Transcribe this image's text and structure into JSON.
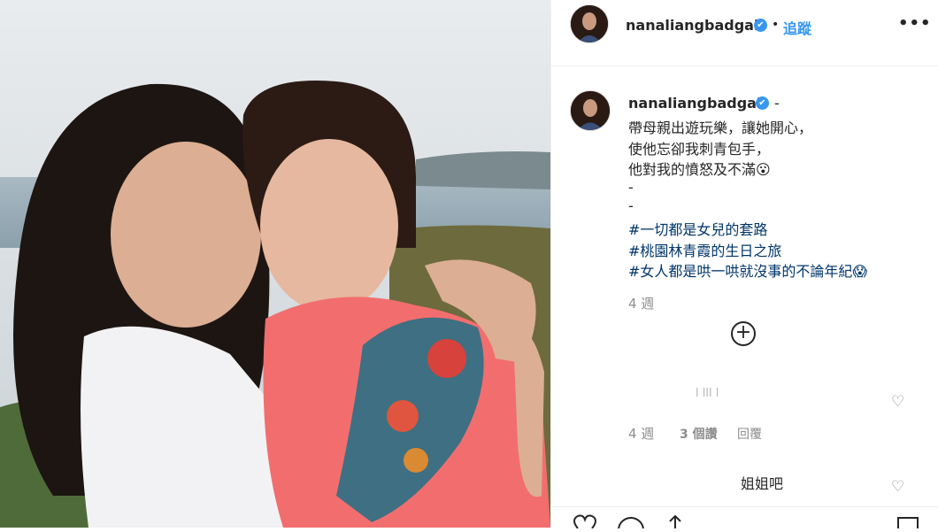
{
  "post": {
    "username": "nanaliangbadgal",
    "verified_glyph": "✔",
    "separator": "•",
    "follow_label": "追蹤",
    "more_label": "•••"
  },
  "caption": {
    "username": "nanaliangbadgal",
    "lines": [
      "-",
      "帶母親出遊玩樂，讓她開心，",
      "使他忘卻我刺青包手，",
      "他對我的憤怒及不滿😮",
      "-",
      "-"
    ],
    "hashtags": [
      "#一切都是女兒的套路",
      "#桃園林青霞的生日之旅",
      "#女人都是哄一哄就沒事的不論年紀😱"
    ],
    "time": "4 週"
  },
  "load_more_icon": "plus-circle-icon",
  "comments": [
    {
      "text": "l lll l",
      "time": "4 週",
      "likes": "3 個讚",
      "reply_label": "回覆"
    },
    {
      "text": "姐姐吧"
    }
  ],
  "icons": {
    "like": "heart-icon",
    "comment": "comment-icon",
    "share": "share-icon",
    "save": "bookmark-icon"
  },
  "colors": {
    "link_blue": "#3897f0",
    "text": "#262626",
    "muted": "#8e8e8e"
  }
}
